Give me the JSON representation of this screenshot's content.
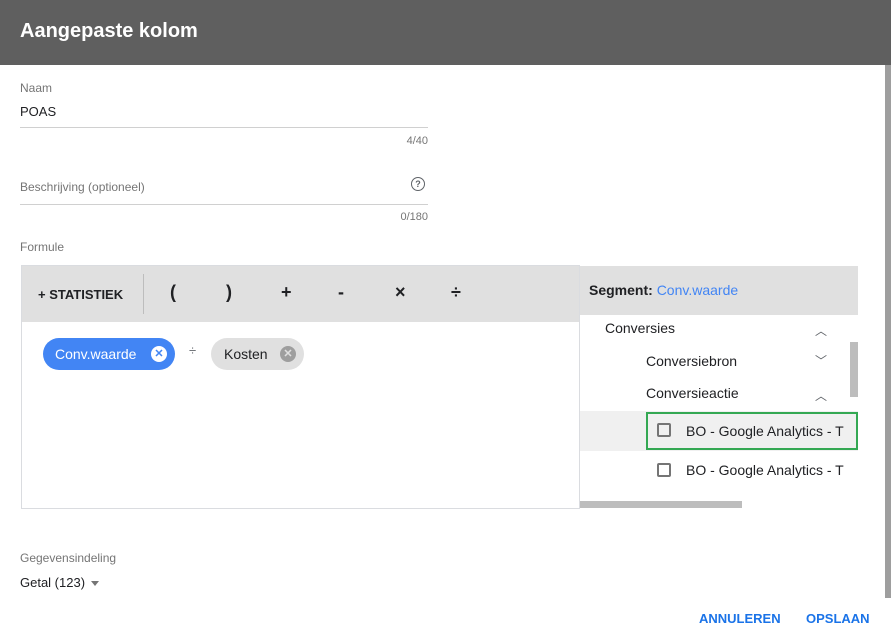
{
  "dialog": {
    "title": "Aangepaste kolom"
  },
  "name_field": {
    "label": "Naam",
    "value": "POAS",
    "counter": "4/40"
  },
  "description_field": {
    "label": "Beschrijving (optioneel)",
    "counter": "0/180",
    "help_icon": "help-circle-icon"
  },
  "formula": {
    "label": "Formule",
    "toolbar": {
      "statistic_button": "+ STATISTIEK",
      "operators": [
        "(",
        ")",
        "+",
        "-",
        "×",
        "÷"
      ]
    },
    "chips": [
      {
        "label": "Conv.waarde",
        "remove_icon": "close-circle-icon"
      },
      {
        "label": "Kosten",
        "remove_icon": "close-circle-icon"
      }
    ],
    "chip_operator": "÷"
  },
  "segment_panel": {
    "label": "Segment:",
    "value": "Conv.waarde",
    "tree": [
      {
        "label": "Conversies",
        "expanded": true,
        "icon": "chevron-up-icon"
      },
      {
        "label": "Conversiebron",
        "expanded": false,
        "icon": "chevron-down-icon"
      },
      {
        "label": "Conversieactie",
        "expanded": true,
        "icon": "chevron-up-icon"
      }
    ],
    "options": [
      {
        "label": "BO - Google Analytics - T",
        "checked": false,
        "highlighted": true
      },
      {
        "label": "BO - Google Analytics - T",
        "checked": false,
        "highlighted": false
      }
    ]
  },
  "data_format": {
    "label": "Gegevensindeling",
    "value": "Getal (123)"
  },
  "footer": {
    "cancel_label": "ANNULEREN",
    "save_label": "OPSLAAN"
  },
  "colors": {
    "header": "#5f5f5f",
    "accent": "#4285f4",
    "chip": "#e0e0e0",
    "highlight_border": "#34a853"
  }
}
